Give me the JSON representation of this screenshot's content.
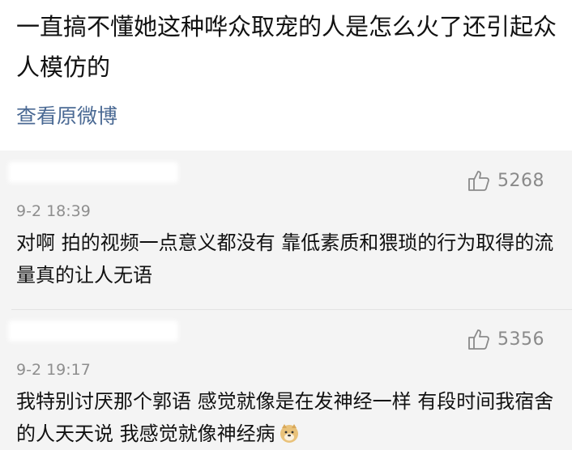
{
  "post": {
    "text": "一直搞不懂她这种哗众取宠的人是怎么火了还引起众人模仿的",
    "view_original_label": "查看原微博"
  },
  "comments": [
    {
      "like_count": "5268",
      "timestamp": "9-2 18:39",
      "text": "对啊 拍的视频一点意义都没有 靠低素质和猥琐的行为取得的流量真的让人无语",
      "icon": "thumbs-up-icon"
    },
    {
      "like_count": "5356",
      "timestamp": "9-2 19:17",
      "text": "我特别讨厌那个郭语 感觉就像是在发神经一样 有段时间我宿舍的人天天说 我感觉就像神经病",
      "emoji": "doge-emoji-icon",
      "icon": "thumbs-up-icon"
    }
  ],
  "colors": {
    "link": "#4b6a94",
    "comment_bg": "#f4f4f4",
    "muted": "#8e8e8e"
  }
}
